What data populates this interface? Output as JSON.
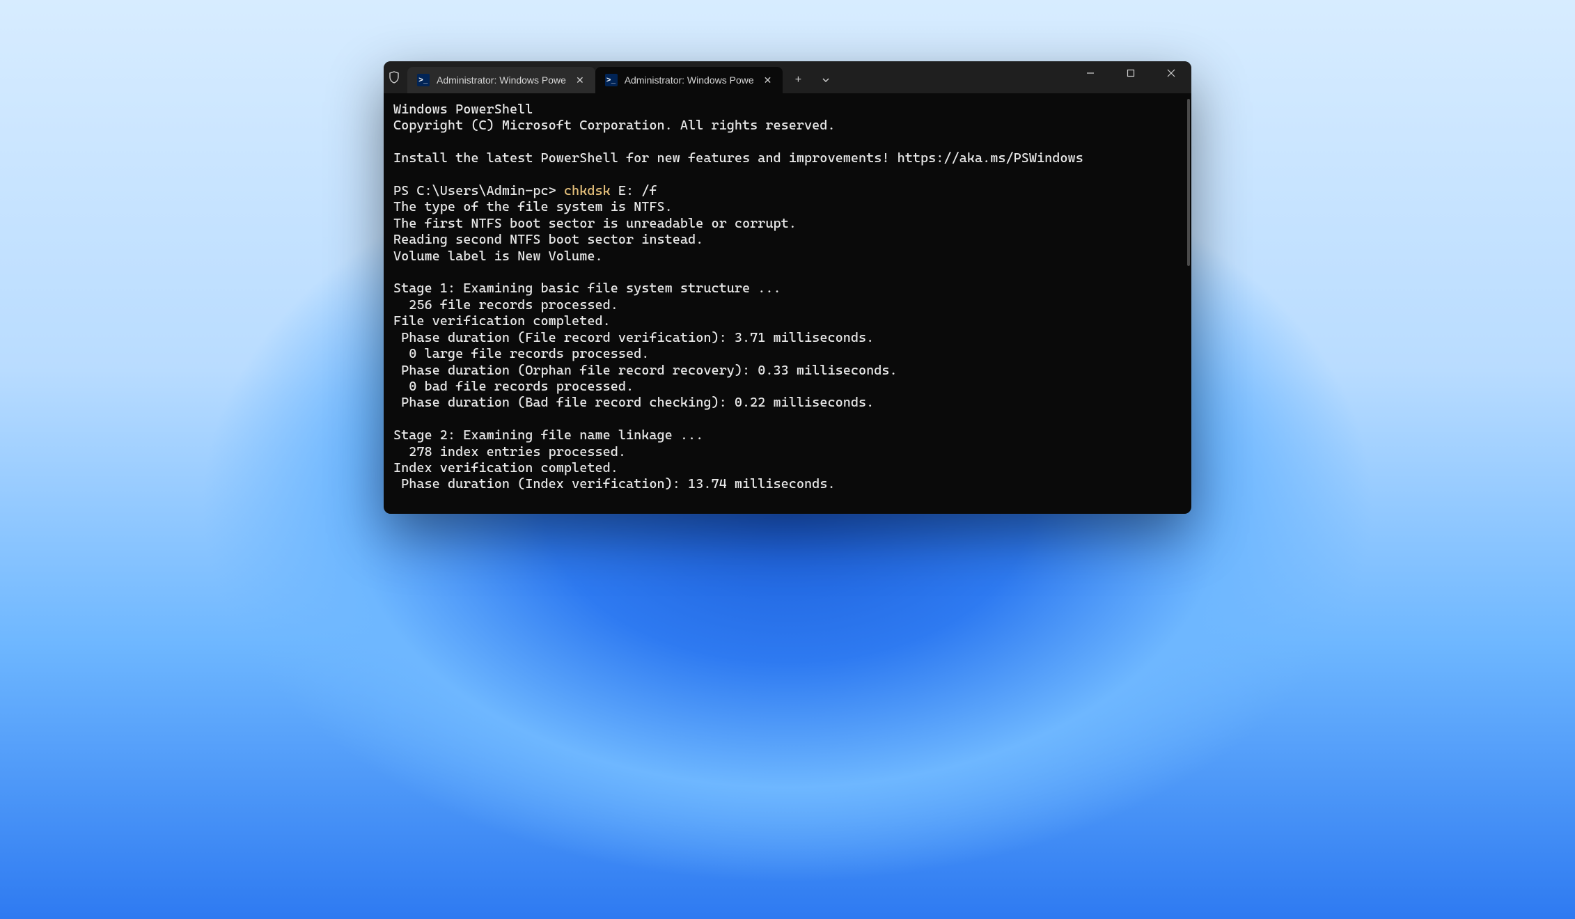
{
  "titlebar": {
    "tabs": [
      {
        "label": "Administrator: Windows Powe",
        "icon": "powershell",
        "active": false
      },
      {
        "label": "Administrator: Windows Powe",
        "icon": "powershell",
        "active": true
      }
    ],
    "new_tab": "+",
    "dropdown": "˅"
  },
  "terminal": {
    "header": [
      "Windows PowerShell",
      "Copyright (C) Microsoft Corporation. All rights reserved.",
      "",
      "Install the latest PowerShell for new features and improvements! https://aka.ms/PSWindows",
      ""
    ],
    "prompt": "PS C:\\Users\\Admin-pc> ",
    "cmd_hl": "chkdsk",
    "cmd_rest": " E: /f",
    "output": [
      "The type of the file system is NTFS.",
      "The first NTFS boot sector is unreadable or corrupt.",
      "Reading second NTFS boot sector instead.",
      "Volume label is New Volume.",
      "",
      "Stage 1: Examining basic file system structure ...",
      "  256 file records processed.",
      "File verification completed.",
      " Phase duration (File record verification): 3.71 milliseconds.",
      "  0 large file records processed.",
      " Phase duration (Orphan file record recovery): 0.33 milliseconds.",
      "  0 bad file records processed.",
      " Phase duration (Bad file record checking): 0.22 milliseconds.",
      "",
      "Stage 2: Examining file name linkage ...",
      "  278 index entries processed.",
      "Index verification completed.",
      " Phase duration (Index verification): 13.74 milliseconds."
    ]
  }
}
